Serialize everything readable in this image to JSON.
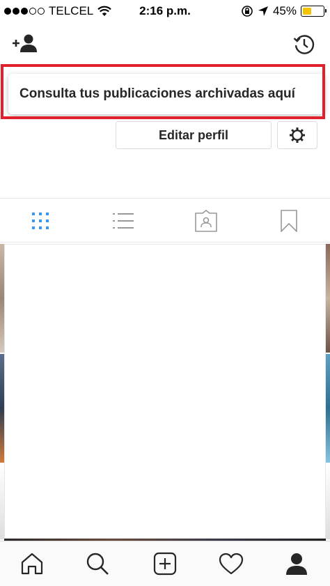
{
  "status_bar": {
    "carrier": "TELCEL",
    "time": "2:16 p.m.",
    "battery_percent": "45%",
    "battery_level": 0.45,
    "battery_color": "#f4c400",
    "icons": [
      "signal-dots-icon",
      "wifi-icon",
      "orientation-lock-icon",
      "location-arrow-icon",
      "battery-icon"
    ]
  },
  "header": {
    "left_icon": "add-person-icon",
    "right_icon": "archive-history-icon"
  },
  "tooltip": {
    "text": "Consulta tus publicaciones archivadas aquí",
    "highlight_color": "#e0202a"
  },
  "profile": {
    "edit_label": "Editar perfil",
    "settings_icon": "gear-icon"
  },
  "tabs": [
    {
      "icon": "grid-icon",
      "active": true
    },
    {
      "icon": "list-icon",
      "active": false
    },
    {
      "icon": "tagged-icon",
      "active": false
    },
    {
      "icon": "bookmark-icon",
      "active": false
    }
  ],
  "bottom_nav": [
    {
      "icon": "home-icon"
    },
    {
      "icon": "search-icon"
    },
    {
      "icon": "add-post-icon"
    },
    {
      "icon": "heart-icon"
    },
    {
      "icon": "profile-icon"
    }
  ],
  "colors": {
    "accent": "#3897f0",
    "text": "#262626",
    "icon_gray": "#999999"
  }
}
